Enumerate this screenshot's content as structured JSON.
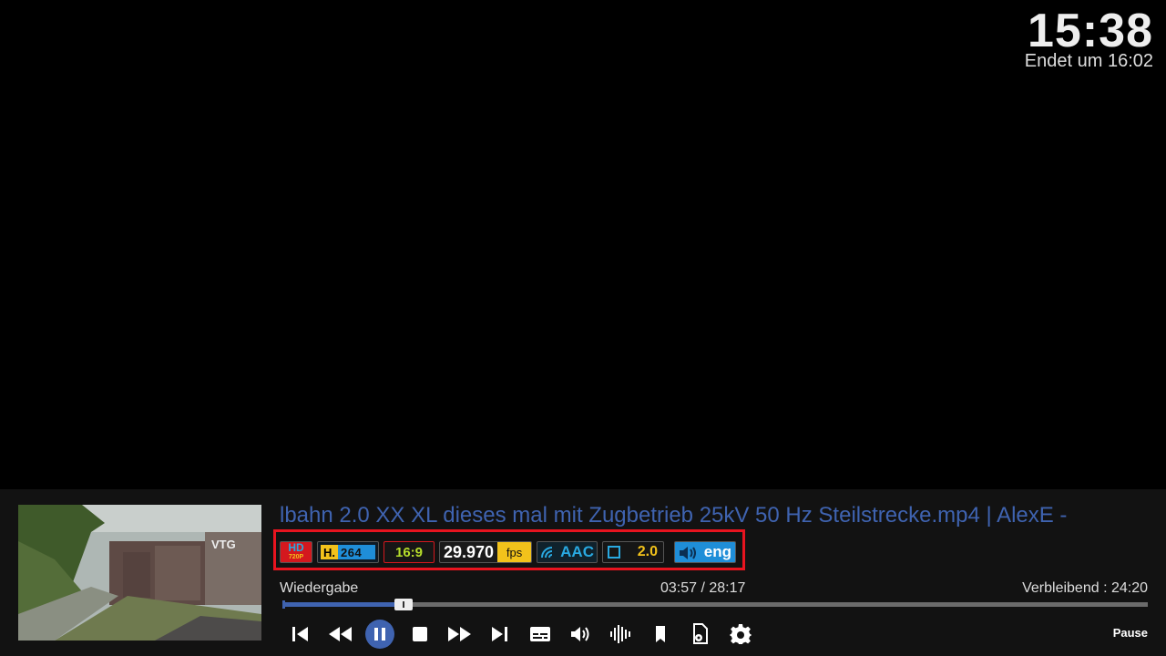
{
  "clock": {
    "time": "15:38",
    "ends": "Endet um 16:02"
  },
  "media": {
    "title": "lbahn 2.0 XX XL dieses mal mit Zugbetrieb 25kV 50 Hz Steilstrecke.mp4 | AlexE -",
    "thumbnail_text": "VTG"
  },
  "badges": {
    "resolution": "HD",
    "resolution_sub": "720P",
    "video_codec_prefix": "H.",
    "video_codec": "264",
    "aspect": "16:9",
    "fps_value": "29.970",
    "fps_unit": "fps",
    "audio_codec": "AAC",
    "channels": "2.0",
    "language": "eng"
  },
  "status": {
    "state": "Wiedergabe",
    "elapsed": "03:57 / 28:17",
    "remaining": "Verbleibend : 24:20",
    "progress_fraction": 0.14,
    "play_state": "Pause"
  },
  "colors": {
    "accent": "#3f63b0",
    "frame": "#e8141f",
    "background": "#121212"
  },
  "controls": [
    "skip-previous-icon",
    "rewind-icon",
    "pause-icon",
    "stop-icon",
    "fast-forward-icon",
    "skip-next-icon",
    "subtitles-icon",
    "volume-icon",
    "audio-stream-icon",
    "bookmark-icon",
    "file-settings-icon",
    "gear-icon"
  ]
}
